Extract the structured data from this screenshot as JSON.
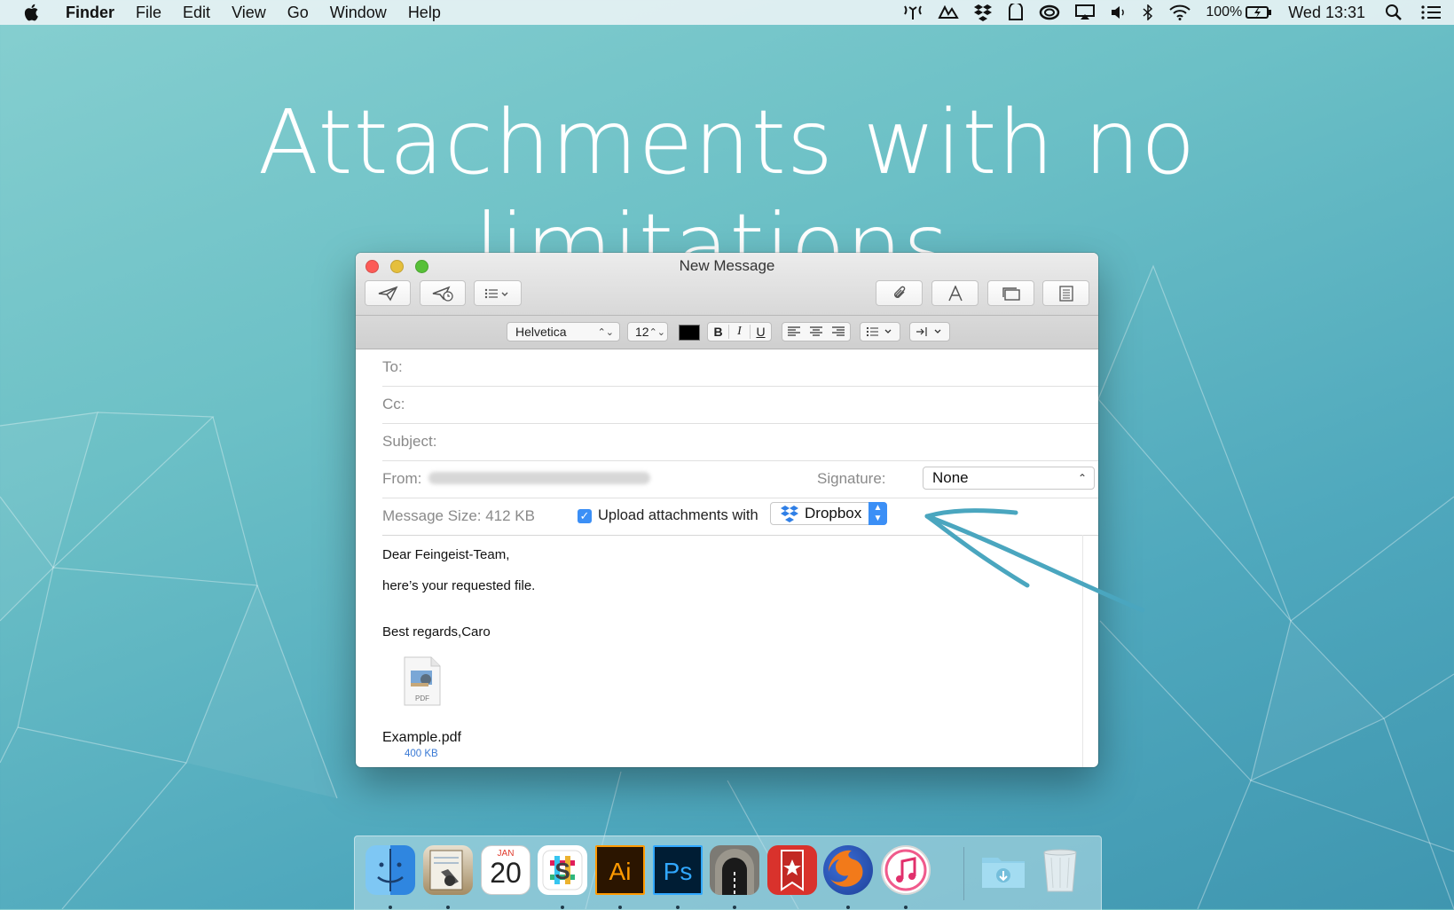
{
  "menubar": {
    "app_name": "Finder",
    "items": [
      "File",
      "Edit",
      "View",
      "Go",
      "Window",
      "Help"
    ],
    "battery": "100%",
    "clock": "Wed 13:31"
  },
  "headline": "Attachments with no limitations.",
  "compose": {
    "window_title": "New Message",
    "format": {
      "font": "Helvetica",
      "size": "12",
      "bold": "B",
      "italic": "I",
      "underline": "U"
    },
    "to_label": "To:",
    "cc_label": "Cc:",
    "subject_label": "Subject:",
    "from_label": "From:",
    "signature_label": "Signature:",
    "signature_value": "None",
    "message_size": "Message Size: 412 KB",
    "upload_checked": true,
    "upload_label": "Upload attachments with",
    "upload_service": "Dropbox",
    "body": {
      "line1": "Dear Feingeist-Team,",
      "line2": "here’s your requested file.",
      "line3": "Best regards,Caro"
    },
    "attachment": {
      "icon_label": "PDF",
      "name": "Example.pdf",
      "size": "400 KB"
    }
  },
  "dock": {
    "calendar_month": "JAN",
    "calendar_day": "20",
    "items": [
      "Finder",
      "Mail app",
      "Calendar",
      "Slack",
      "Illustrator",
      "Photoshop",
      "Tunnel app",
      "Wunderlist",
      "Firefox",
      "iTunes",
      "Downloads",
      "Trash"
    ]
  },
  "colors": {
    "accent_blue": "#3b8ff6",
    "arrow": "#4aa6bf",
    "illustrator": "#ff9a00",
    "photoshop": "#31a8ff"
  }
}
